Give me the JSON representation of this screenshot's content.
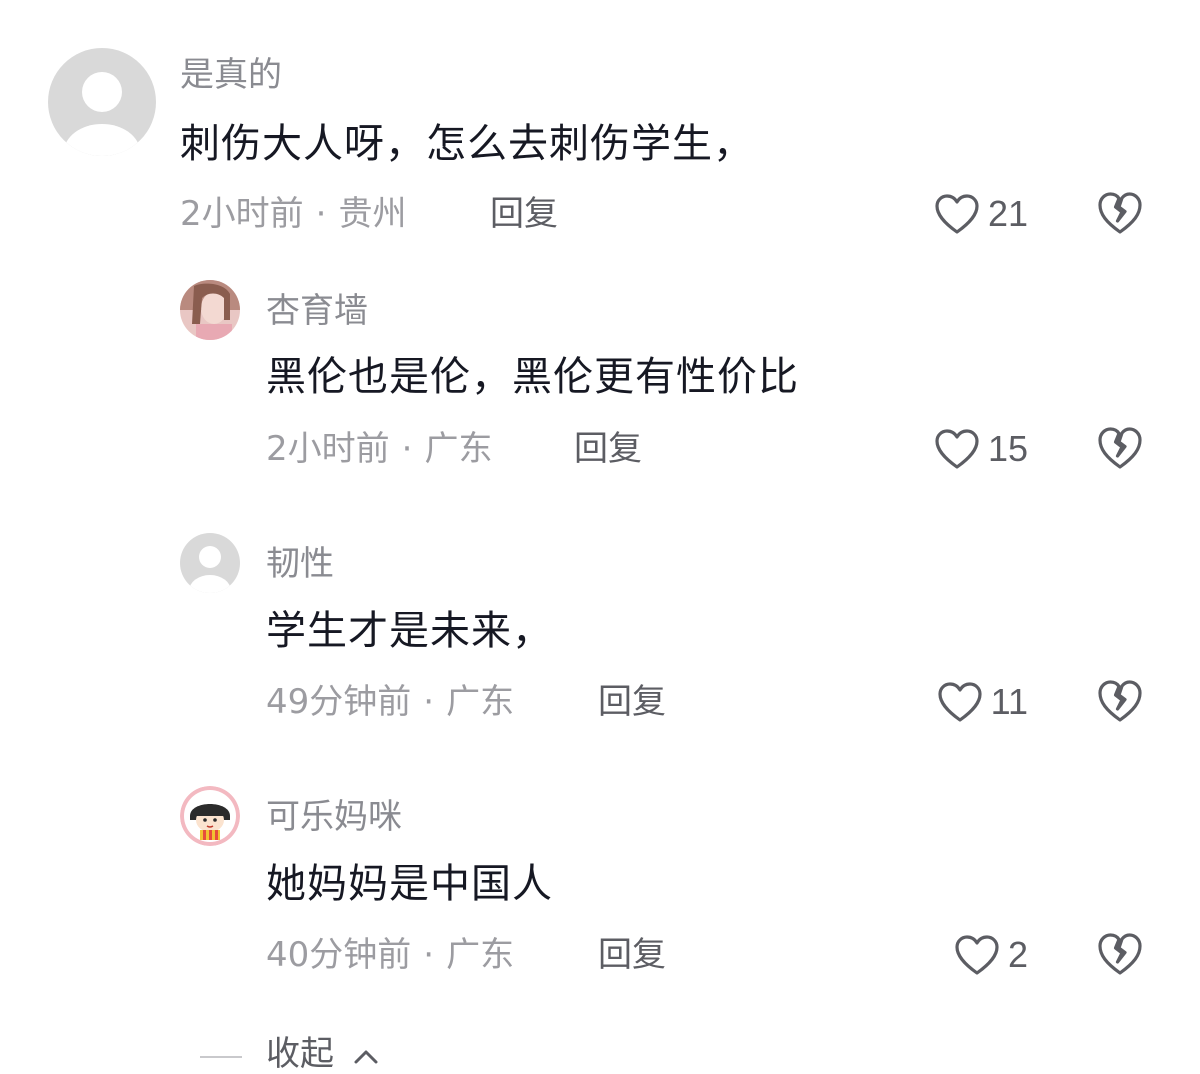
{
  "comments": [
    {
      "username": "是真的",
      "content": "刺伤大人呀，怎么去刺伤学生，",
      "time": "2小时前",
      "location": "贵州",
      "reply_label": "回复",
      "likes": "21"
    },
    {
      "username": "杏育墙",
      "content": "黑伦也是伦，黑伦更有性价比",
      "time": "2小时前",
      "location": "广东",
      "reply_label": "回复",
      "likes": "15"
    },
    {
      "username": "韧性",
      "content": "学生才是未来，",
      "time": "49分钟前",
      "location": "广东",
      "reply_label": "回复",
      "likes": "11"
    },
    {
      "username": "可乐妈咪",
      "content": "她妈妈是中国人",
      "time": "40分钟前",
      "location": "广东",
      "reply_label": "回复",
      "likes": "2"
    }
  ],
  "collapse": {
    "label": "收起"
  },
  "colors": {
    "text_primary": "#161823",
    "text_secondary": "#8a8b91",
    "icon_gray": "#5c5d63",
    "avatar_default_bg": "#d8d8d8"
  },
  "icons": {
    "like": "heart-outline-icon",
    "dislike": "broken-heart-icon",
    "collapse": "chevron-up-icon"
  }
}
